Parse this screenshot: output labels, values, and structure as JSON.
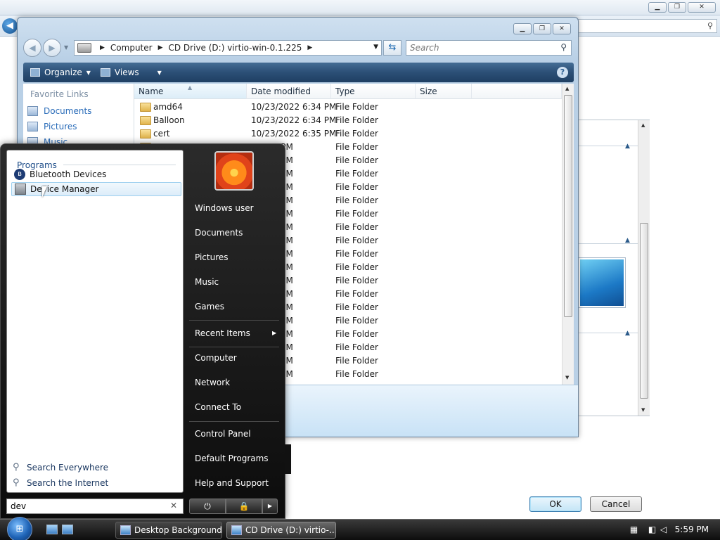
{
  "background_window": {
    "ok_label": "OK",
    "cancel_label": "Cancel"
  },
  "explorer": {
    "address": {
      "crumbs": [
        "Computer",
        "CD Drive (D:) virtio-win-0.1.225"
      ]
    },
    "search_placeholder": "Search",
    "toolbar": {
      "organize_label": "Organize",
      "views_label": "Views"
    },
    "favorites": {
      "header": "Favorite Links",
      "items": [
        "Documents",
        "Pictures",
        "Music"
      ]
    },
    "columns": [
      "Name",
      "Date modified",
      "Type",
      "Size"
    ],
    "rows": [
      {
        "name": "amd64",
        "date": "10/23/2022 6:34 PM",
        "type": "File Folder",
        "size": ""
      },
      {
        "name": "Balloon",
        "date": "10/23/2022 6:34 PM",
        "type": "File Folder",
        "size": ""
      },
      {
        "name": "cert",
        "date": "10/23/2022 6:35 PM",
        "type": "File Folder",
        "size": ""
      },
      {
        "name": "",
        "date": "2 6:34 PM",
        "type": "File Folder",
        "size": ""
      },
      {
        "name": "",
        "date": "2 6:34 PM",
        "type": "File Folder",
        "size": ""
      },
      {
        "name": "",
        "date": "2 7:03 PM",
        "type": "File Folder",
        "size": ""
      },
      {
        "name": "",
        "date": "2 6:34 PM",
        "type": "File Folder",
        "size": ""
      },
      {
        "name": "",
        "date": "2 6:34 PM",
        "type": "File Folder",
        "size": ""
      },
      {
        "name": "",
        "date": "2 6:34 PM",
        "type": "File Folder",
        "size": ""
      },
      {
        "name": "",
        "date": "2 6:34 PM",
        "type": "File Folder",
        "size": ""
      },
      {
        "name": "",
        "date": "2 6:34 PM",
        "type": "File Folder",
        "size": ""
      },
      {
        "name": "",
        "date": "2 6:34 PM",
        "type": "File Folder",
        "size": ""
      },
      {
        "name": "",
        "date": "2 6:34 PM",
        "type": "File Folder",
        "size": ""
      },
      {
        "name": "",
        "date": "2 6:34 PM",
        "type": "File Folder",
        "size": ""
      },
      {
        "name": "",
        "date": "2 6:34 PM",
        "type": "File Folder",
        "size": ""
      },
      {
        "name": "",
        "date": "2 6:34 PM",
        "type": "File Folder",
        "size": ""
      },
      {
        "name": "",
        "date": "2 6:34 PM",
        "type": "File Folder",
        "size": ""
      },
      {
        "name": "",
        "date": "2 6:34 PM",
        "type": "File Folder",
        "size": ""
      },
      {
        "name": "",
        "date": "2 6:34 PM",
        "type": "File Folder",
        "size": ""
      },
      {
        "name": "",
        "date": "2 6:34 PM",
        "type": "File Folder",
        "size": ""
      },
      {
        "name": "",
        "date": "2 6:34 PM",
        "type": "File Folder",
        "size": ""
      }
    ]
  },
  "start_menu": {
    "programs_header": "Programs",
    "programs": [
      "Bluetooth Devices",
      "Device Manager"
    ],
    "search_everywhere": "Search Everywhere",
    "search_internet": "Search the Internet",
    "search_value": "dev",
    "right_items": [
      "Windows user",
      "Documents",
      "Pictures",
      "Music",
      "Games",
      "Recent Items",
      "Computer",
      "Network",
      "Connect To",
      "Control Panel",
      "Default Programs",
      "Help and Support"
    ]
  },
  "taskbar": {
    "tasks": [
      "Desktop Background",
      "CD Drive (D:) virtio-..."
    ],
    "clock": "5:59 PM"
  },
  "colors": {
    "toolbar": "#2b4f76",
    "link": "#2a6cb9",
    "start_menu": "#1a1a1a"
  }
}
